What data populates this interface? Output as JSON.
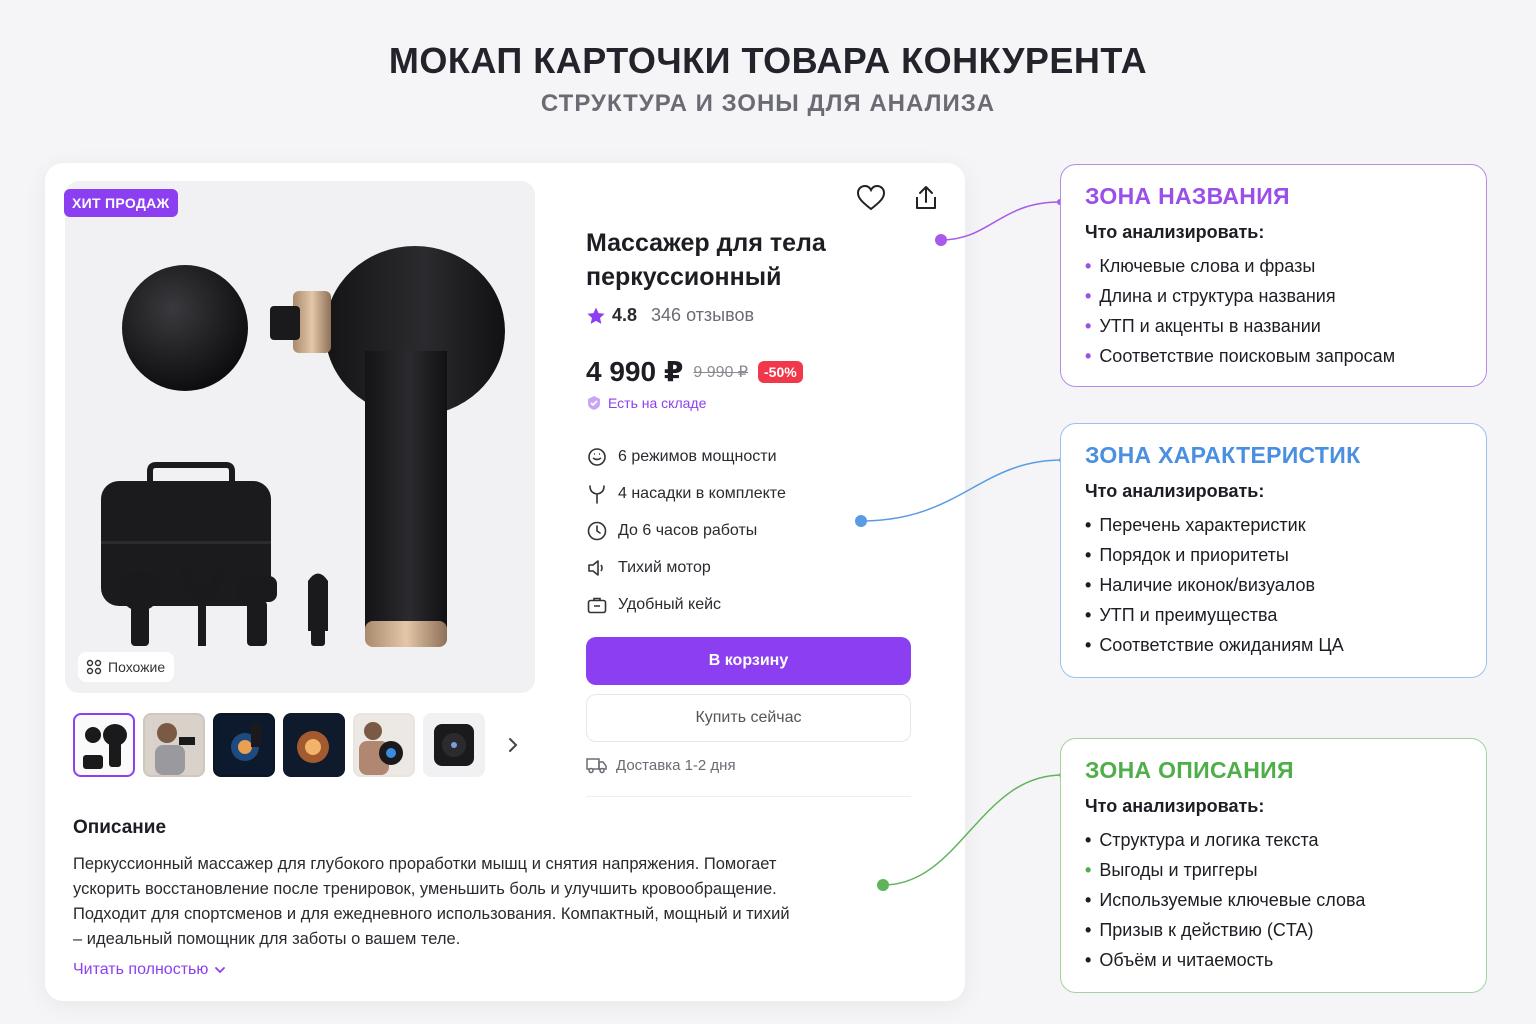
{
  "header": {
    "title": "МОКАП КАРТОЧКИ ТОВАРА КОНКУРЕНТА",
    "subtitle": "СТРУКТУРА И ЗОНЫ ДЛЯ АНАЛИЗА"
  },
  "card": {
    "badge": "ХИТ ПРОДАЖ",
    "similar_label": "Похожие",
    "title": "Массажер для тела перкуссионный",
    "rating": "4.8",
    "reviews": "346 отзывов",
    "price": "4 990 ₽",
    "old_price": "9 990 ₽",
    "discount": "-50%",
    "stock": "Есть на складе",
    "features": [
      {
        "icon": "power-modes-icon",
        "label": "6 режимов мощности"
      },
      {
        "icon": "attachments-icon",
        "label": "4 насадки в комплекте"
      },
      {
        "icon": "clock-icon",
        "label": "До 6 часов работы"
      },
      {
        "icon": "speaker-icon",
        "label": "Тихий мотор"
      },
      {
        "icon": "case-icon",
        "label": "Удобный кейс"
      }
    ],
    "cart_button": "В корзину",
    "buy_button": "Купить сейчас",
    "delivery": "Доставка 1-2 дня",
    "description_title": "Описание",
    "description_text": "Перкуссионный массажер для глубокого проработки мышц и снятия напряжения. Помогает ускорить восстановление после тренировок, уменьшить боль и улучшить кровообращение. Подходит для спортсменов и для ежедневного использования. Компактный, мощный и тихий – идеальный помощник для заботы о вашем теле.",
    "read_more": "Читать полностью"
  },
  "zones": [
    {
      "title": "ЗОНА НАЗВАНИЯ",
      "color": "#9b4ee8",
      "label": "Что анализировать:",
      "items": [
        "Ключевые слова и фразы",
        "Длина и структура названия",
        "УТП и акценты в названии",
        "Соответствие поисковым запросам"
      ]
    },
    {
      "title": "ЗОНА ХАРАКТЕРИСТИК",
      "color": "#4a8fe0",
      "label": "Что анализировать:",
      "items": [
        "Перечень характеристик",
        "Порядок и приоритеты",
        "Наличие иконок/визуалов",
        "УТП и преимущества",
        "Соответствие ожиданиям ЦА"
      ]
    },
    {
      "title": "ЗОНА ОПИСАНИЯ",
      "color": "#4fae4a",
      "label": "Что анализировать:",
      "items": [
        "Структура и логика текста",
        "Выгоды и триггеры",
        "Используемые ключевые слова",
        "Призыв к действию (CTA)",
        "Объём и читаемость"
      ]
    }
  ],
  "colors": {
    "accent": "#8b3ff0",
    "discount": "#f0384a"
  }
}
